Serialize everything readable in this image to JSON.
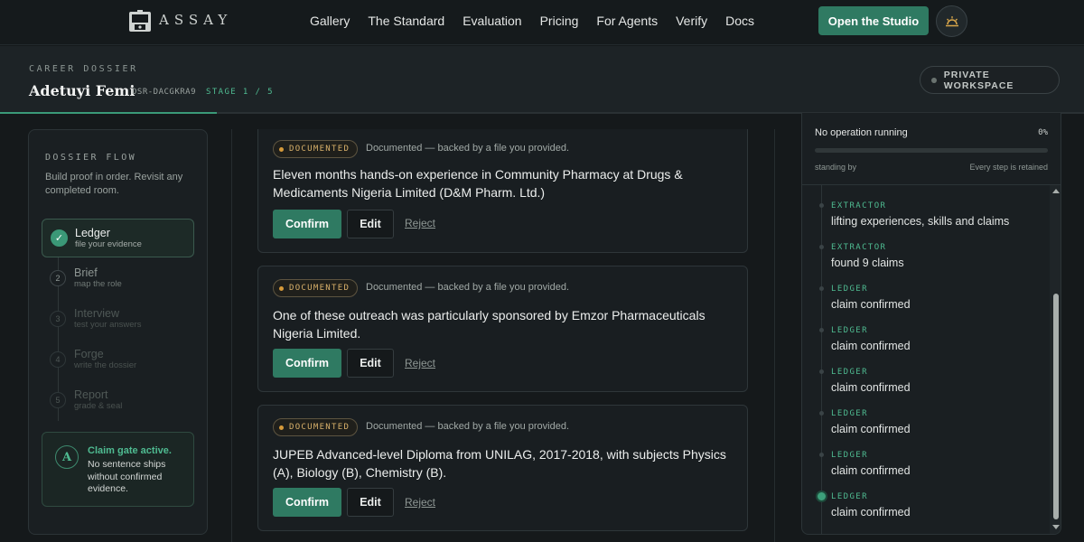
{
  "nav": {
    "brand": "ASSAY",
    "links": [
      "Gallery",
      "The Standard",
      "Evaluation",
      "Pricing",
      "For Agents",
      "Verify",
      "Docs"
    ],
    "cta": "Open the Studio",
    "theme_icon": "sun-horizon-icon"
  },
  "header": {
    "kicker": "CAREER DOSSIER",
    "name": "Adetuyi Femi",
    "dossier_id": "DSR-DACGKRA9",
    "stage": "STAGE 1 / 5",
    "workspace": "PRIVATE WORKSPACE",
    "stage_progress": 0.2
  },
  "sidebar": {
    "title": "DOSSIER FLOW",
    "description": "Build proof in order. Revisit any completed room.",
    "steps": [
      {
        "num": "✓",
        "label": "Ledger",
        "sub": "file your evidence"
      },
      {
        "num": "2",
        "label": "Brief",
        "sub": "map the role"
      },
      {
        "num": "3",
        "label": "Interview",
        "sub": "test your answers"
      },
      {
        "num": "4",
        "label": "Forge",
        "sub": "write the dossier"
      },
      {
        "num": "5",
        "label": "Report",
        "sub": "grade & seal"
      }
    ],
    "gate": {
      "badge": "A",
      "title": "Claim gate active.",
      "text": "No sentence ships without confirmed evidence."
    }
  },
  "claims": [
    {
      "badge": "DOCUMENTED",
      "note": "Documented — backed by a file you provided.",
      "text": "Eleven months hands-on experience in Community Pharmacy at Drugs & Medicaments Nigeria Limited (D&M Pharm. Ltd.)",
      "confirm": "Confirm",
      "edit": "Edit",
      "reject": "Reject"
    },
    {
      "badge": "DOCUMENTED",
      "note": "Documented — backed by a file you provided.",
      "text": "One of these outreach was particularly sponsored by Emzor Pharmaceuticals Nigeria Limited.",
      "confirm": "Confirm",
      "edit": "Edit",
      "reject": "Reject"
    },
    {
      "badge": "DOCUMENTED",
      "note": "Documented — backed by a file you provided.",
      "text": "JUPEB Advanced-level Diploma from UNILAG, 2017-2018, with subjects Physics (A), Biology (B), Chemistry (B).",
      "confirm": "Confirm",
      "edit": "Edit",
      "reject": "Reject"
    }
  ],
  "activity": {
    "status": "No operation running",
    "percent": "0%",
    "progress": 0,
    "idle": "standing by",
    "retained": "Every step is retained",
    "events": [
      {
        "tag": "EXTRACTOR",
        "text": "lifting experiences, skills and claims"
      },
      {
        "tag": "EXTRACTOR",
        "text": "found 9 claims"
      },
      {
        "tag": "LEDGER",
        "text": "claim confirmed"
      },
      {
        "tag": "LEDGER",
        "text": "claim confirmed"
      },
      {
        "tag": "LEDGER",
        "text": "claim confirmed"
      },
      {
        "tag": "LEDGER",
        "text": "claim confirmed"
      },
      {
        "tag": "LEDGER",
        "text": "claim confirmed"
      },
      {
        "tag": "LEDGER",
        "text": "claim confirmed"
      }
    ]
  },
  "colors": {
    "accent": "#2f7a62",
    "accent_text": "#4fbb91",
    "documented": "#d8b06a",
    "background": "#15191b"
  }
}
